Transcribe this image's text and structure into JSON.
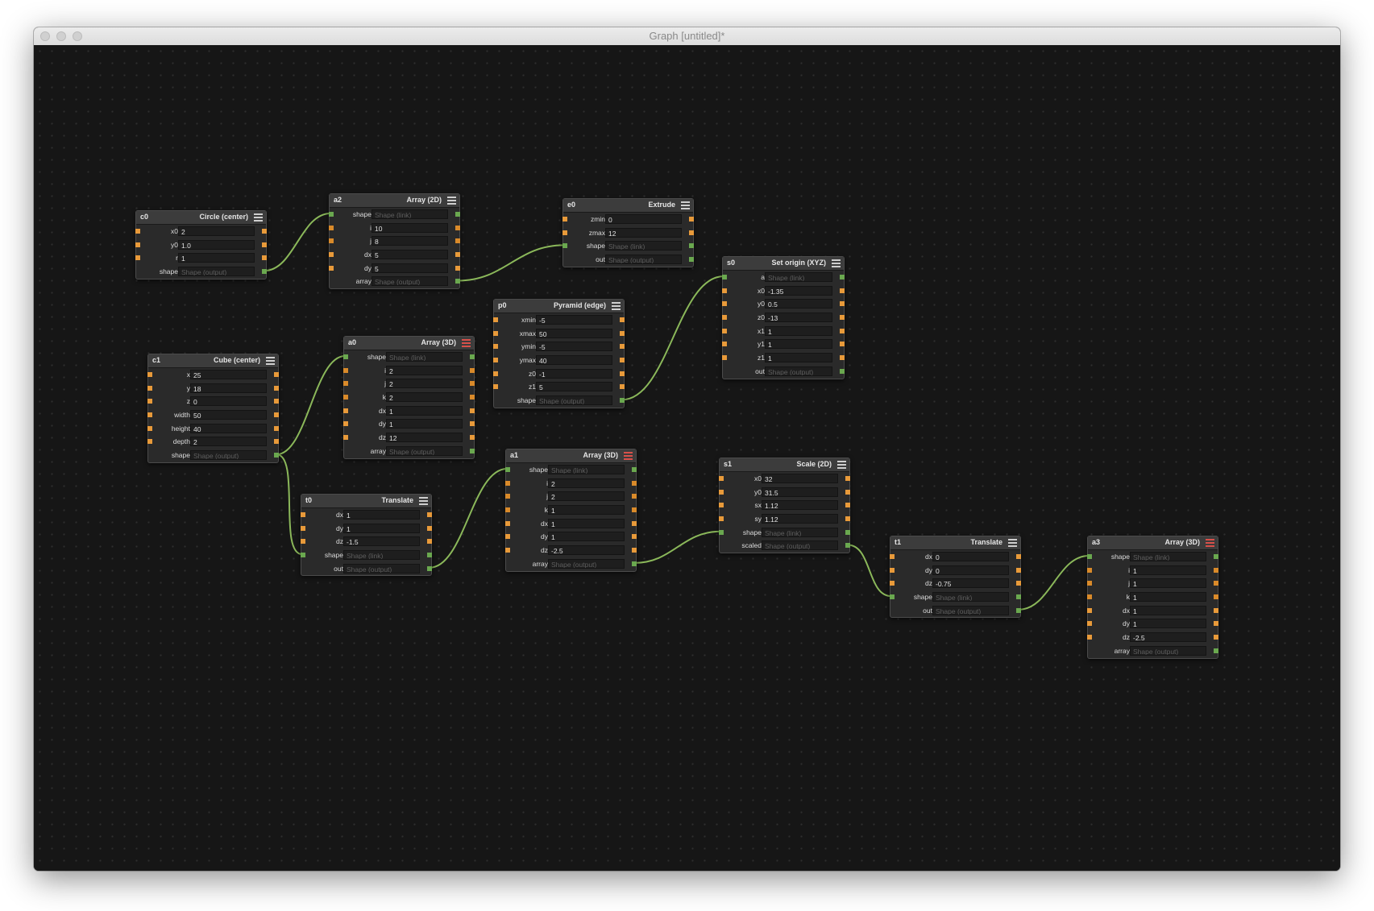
{
  "window": {
    "title": "Graph [untitled]*"
  },
  "colors": {
    "wire": "#8bb85a",
    "number_port": "#e89a3a",
    "shape_port": "#6aa84f",
    "error_menu": "#d8504a"
  },
  "nodes": {
    "c0": {
      "id": "c0",
      "title": "Circle (center)",
      "rows": [
        {
          "label": "x0",
          "value": "2"
        },
        {
          "label": "y0",
          "value": "1.0"
        },
        {
          "label": "r",
          "value": "1"
        },
        {
          "label": "shape",
          "value": "Shape (output)"
        }
      ]
    },
    "a2": {
      "id": "a2",
      "title": "Array (2D)",
      "rows": [
        {
          "label": "shape",
          "value": "Shape (link)"
        },
        {
          "label": "i",
          "value": "10"
        },
        {
          "label": "j",
          "value": "8"
        },
        {
          "label": "dx",
          "value": "5"
        },
        {
          "label": "dy",
          "value": "5"
        },
        {
          "label": "array",
          "value": "Shape (output)"
        }
      ]
    },
    "e0": {
      "id": "e0",
      "title": "Extrude",
      "rows": [
        {
          "label": "zmin",
          "value": "0"
        },
        {
          "label": "zmax",
          "value": "12"
        },
        {
          "label": "shape",
          "value": "Shape (link)"
        },
        {
          "label": "out",
          "value": "Shape (output)"
        }
      ]
    },
    "s0": {
      "id": "s0",
      "title": "Set origin (XYZ)",
      "rows": [
        {
          "label": "a",
          "value": "Shape (link)"
        },
        {
          "label": "x0",
          "value": "-1.35"
        },
        {
          "label": "y0",
          "value": "0.5"
        },
        {
          "label": "z0",
          "value": "-13"
        },
        {
          "label": "x1",
          "value": "1"
        },
        {
          "label": "y1",
          "value": "1"
        },
        {
          "label": "z1",
          "value": "1"
        },
        {
          "label": "out",
          "value": "Shape (output)"
        }
      ]
    },
    "p0": {
      "id": "p0",
      "title": "Pyramid (edge)",
      "rows": [
        {
          "label": "xmin",
          "value": "-5"
        },
        {
          "label": "xmax",
          "value": "50"
        },
        {
          "label": "ymin",
          "value": "-5"
        },
        {
          "label": "ymax",
          "value": "40"
        },
        {
          "label": "z0",
          "value": "-1"
        },
        {
          "label": "z1",
          "value": "5"
        },
        {
          "label": "shape",
          "value": "Shape (output)"
        }
      ]
    },
    "c1": {
      "id": "c1",
      "title": "Cube (center)",
      "rows": [
        {
          "label": "x",
          "value": "25"
        },
        {
          "label": "y",
          "value": "18"
        },
        {
          "label": "z",
          "value": "0"
        },
        {
          "label": "width",
          "value": "50"
        },
        {
          "label": "height",
          "value": "40"
        },
        {
          "label": "depth",
          "value": "2"
        },
        {
          "label": "shape",
          "value": "Shape (output)"
        }
      ]
    },
    "a0": {
      "id": "a0",
      "title": "Array (3D)",
      "rows": [
        {
          "label": "shape",
          "value": "Shape (link)"
        },
        {
          "label": "i",
          "value": "2"
        },
        {
          "label": "j",
          "value": "2"
        },
        {
          "label": "k",
          "value": "2"
        },
        {
          "label": "dx",
          "value": "1"
        },
        {
          "label": "dy",
          "value": "1"
        },
        {
          "label": "dz",
          "value": "12"
        },
        {
          "label": "array",
          "value": "Shape (output)"
        }
      ]
    },
    "t0": {
      "id": "t0",
      "title": "Translate",
      "rows": [
        {
          "label": "dx",
          "value": "1"
        },
        {
          "label": "dy",
          "value": "1"
        },
        {
          "label": "dz",
          "value": "-1.5"
        },
        {
          "label": "shape",
          "value": "Shape (link)"
        },
        {
          "label": "out",
          "value": "Shape (output)"
        }
      ]
    },
    "a1": {
      "id": "a1",
      "title": "Array (3D)",
      "rows": [
        {
          "label": "shape",
          "value": "Shape (link)"
        },
        {
          "label": "i",
          "value": "2"
        },
        {
          "label": "j",
          "value": "2"
        },
        {
          "label": "k",
          "value": "1"
        },
        {
          "label": "dx",
          "value": "1"
        },
        {
          "label": "dy",
          "value": "1"
        },
        {
          "label": "dz",
          "value": "-2.5"
        },
        {
          "label": "array",
          "value": "Shape (output)"
        }
      ]
    },
    "s1": {
      "id": "s1",
      "title": "Scale (2D)",
      "rows": [
        {
          "label": "x0",
          "value": "32"
        },
        {
          "label": "y0",
          "value": "31.5"
        },
        {
          "label": "sx",
          "value": "1.12"
        },
        {
          "label": "sy",
          "value": "1.12"
        },
        {
          "label": "shape",
          "value": "Shape (link)"
        },
        {
          "label": "scaled",
          "value": "Shape (output)"
        }
      ]
    },
    "t1": {
      "id": "t1",
      "title": "Translate",
      "rows": [
        {
          "label": "dx",
          "value": "0"
        },
        {
          "label": "dy",
          "value": "0"
        },
        {
          "label": "dz",
          "value": "-0.75"
        },
        {
          "label": "shape",
          "value": "Shape (link)"
        },
        {
          "label": "out",
          "value": "Shape (output)"
        }
      ]
    },
    "a3": {
      "id": "a3",
      "title": "Array (3D)",
      "rows": [
        {
          "label": "shape",
          "value": "Shape (link)"
        },
        {
          "label": "i",
          "value": "1"
        },
        {
          "label": "j",
          "value": "1"
        },
        {
          "label": "k",
          "value": "1"
        },
        {
          "label": "dx",
          "value": "1"
        },
        {
          "label": "dy",
          "value": "1"
        },
        {
          "label": "dz",
          "value": "-2.5"
        },
        {
          "label": "array",
          "value": "Shape (output)"
        }
      ]
    }
  }
}
